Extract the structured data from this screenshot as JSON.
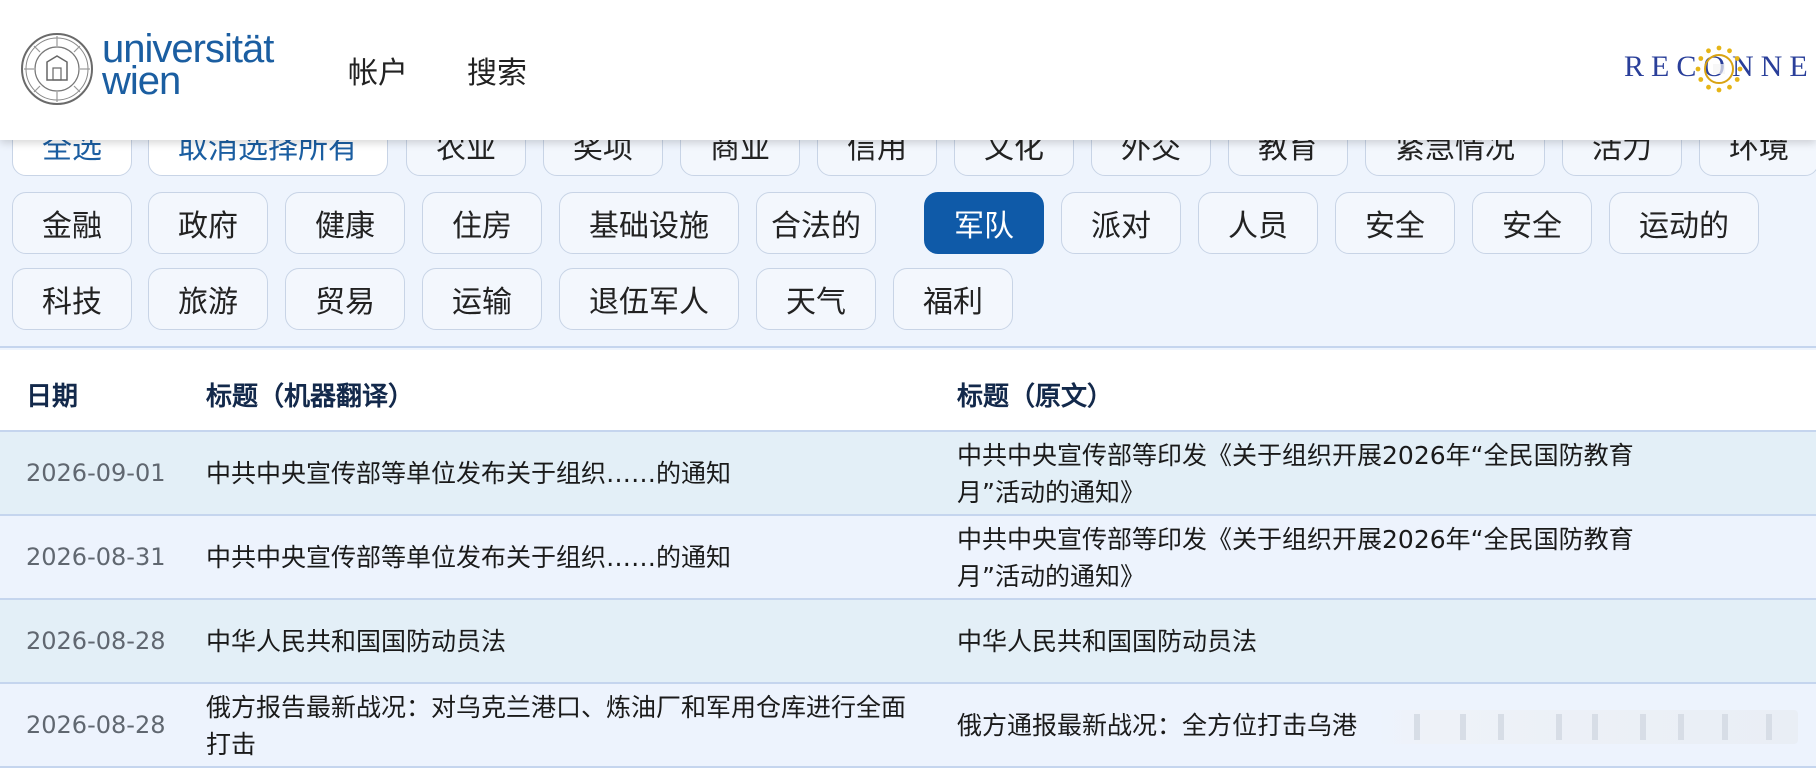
{
  "header": {
    "logo_line1": "universität",
    "logo_line2": "wien",
    "nav": {
      "account": "帐户",
      "search": "搜索"
    },
    "partner_logo": "RECONNE"
  },
  "filters": {
    "select_all": "全选",
    "deselect_all": "取消选择所有",
    "categories_row1": [
      "农业",
      "奖项",
      "商业",
      "信用",
      "文化",
      "外交",
      "教育",
      "紧急情况",
      "活力",
      "环境"
    ],
    "categories_row2": [
      "金融",
      "政府",
      "健康",
      "住房",
      "基础设施",
      "合法的",
      "军队",
      "派对",
      "人员",
      "安全",
      "安全",
      "运动的"
    ],
    "categories_row3": [
      "科技",
      "旅游",
      "贸易",
      "运输",
      "退伍军人",
      "天气",
      "福利"
    ],
    "active": "军队"
  },
  "table": {
    "headers": {
      "date": "日期",
      "title_mt": "标题（机器翻译）",
      "title_orig": "标题（原文）"
    },
    "rows": [
      {
        "date": "2026-09-01",
        "title_mt": "中共中央宣传部等单位发布关于组织……的通知",
        "title_orig": "中共中央宣传部等印发《关于组织开展2026年“全民国防教育月”活动的通知》"
      },
      {
        "date": "2026-08-31",
        "title_mt": "中共中央宣传部等单位发布关于组织……的通知",
        "title_orig": "中共中央宣传部等印发《关于组织开展2026年“全民国防教育月”活动的通知》"
      },
      {
        "date": "2026-08-28",
        "title_mt": "中华人民共和国国防动员法",
        "title_orig": "中华人民共和国国防动员法"
      },
      {
        "date": "2026-08-28",
        "title_mt": "俄方报告最新战况：对乌克兰港口、炼油厂和军用仓库进行全面打击",
        "title_orig": "俄方通报最新战况：全方位打击乌港"
      }
    ]
  },
  "colors": {
    "brand": "#1b5ea1",
    "active_chip": "#0f5aa8",
    "header_text": "#13294b"
  }
}
